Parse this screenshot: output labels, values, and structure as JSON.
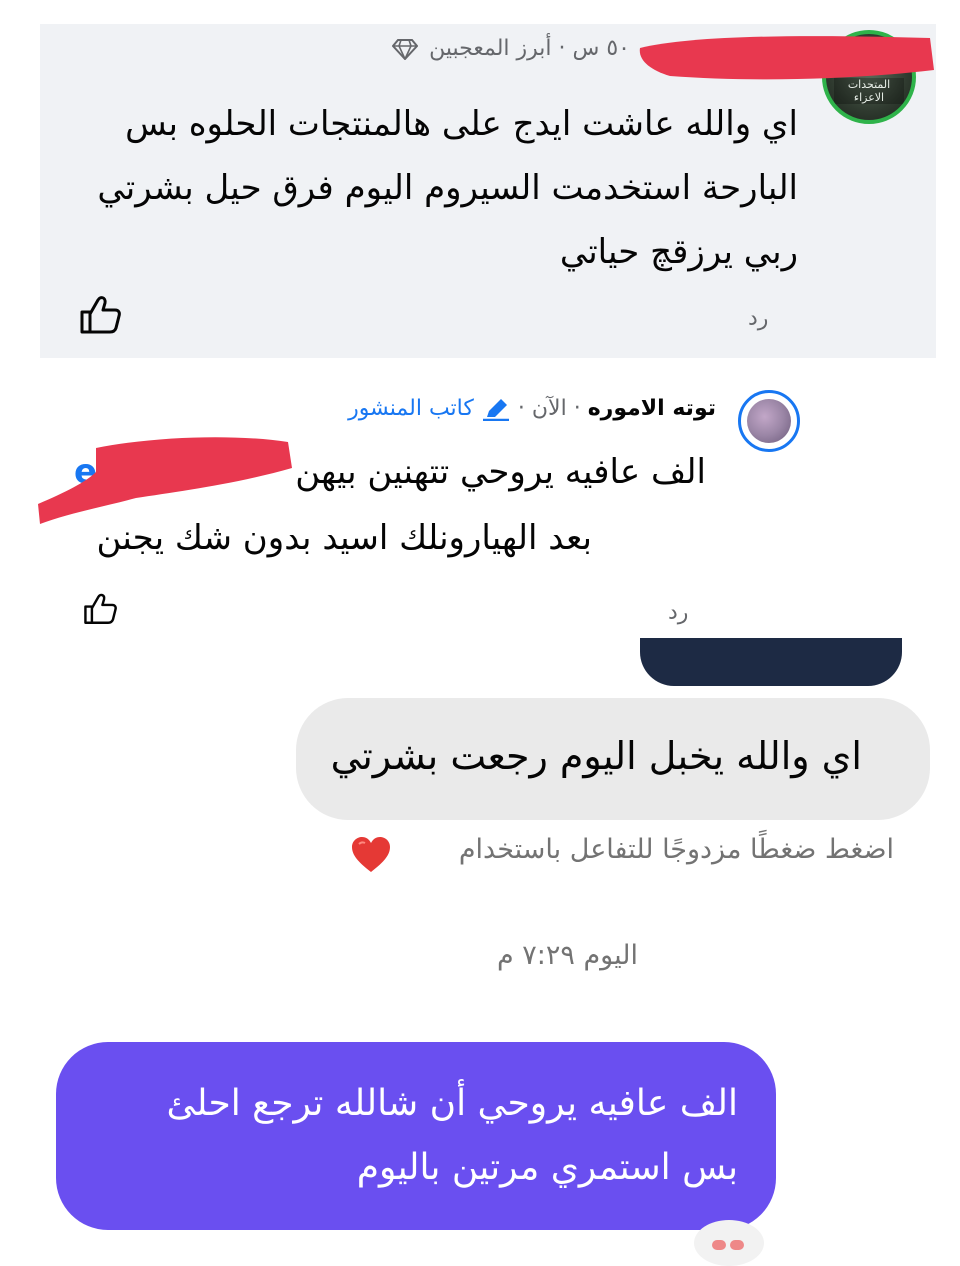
{
  "comment1": {
    "meta": "٥٠ س · أبرز المعجبين",
    "lines": [
      "اي والله عاشت ايدج على هالمنتجات الحلوه بس",
      "البارحة استخدمت السيروم اليوم فرق حيل بشرتي",
      "ربي يرزقچ حياتي"
    ],
    "reply_label": "رد",
    "like_icon": "thumbs-up-icon",
    "badge_icon": "diamond-icon",
    "avatar_text": "المتحدات الاعزاء"
  },
  "comment2": {
    "author": "توته الاموره",
    "separator": "·",
    "time": "الآن",
    "author_badge": "كاتب المنشور",
    "mention_visible": "er",
    "line1": "الف عافيه يروحي تتهنين بيهن",
    "line2": "بعد الهيارونلك اسيد بدون شك يجنن",
    "reply_label": "رد",
    "like_icon": "thumbs-up-icon",
    "badge_icon": "pencil-icon"
  },
  "chat": {
    "incoming_message": "اي والله يخبل اليوم رجعت بشرتي",
    "hint": "اضغط ضغطًا مزدوجًا للتفاعل باستخدام",
    "hint_icon": "heart-icon",
    "timestamp": "اليوم ٧:٢٩ م",
    "outgoing_lines": [
      "الف عافيه يروحي أن شالله ترجع احلئ",
      "بس استمري مرتين باليوم"
    ],
    "outgoing_color": "#6a4ff0"
  },
  "colors": {
    "card_bg": "#f0f2f5",
    "link_blue": "#1877f2",
    "redaction": "#e8384f",
    "incoming_bg": "#eaeaea"
  }
}
